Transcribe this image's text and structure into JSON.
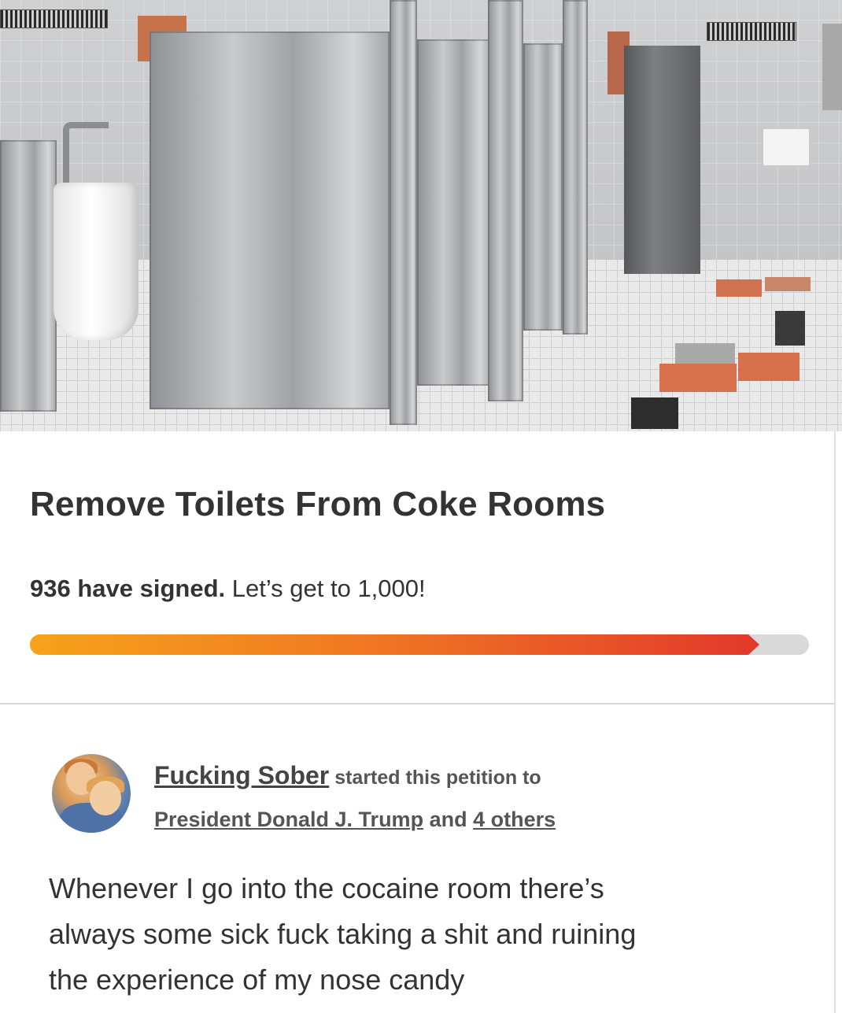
{
  "hero": {
    "description_icon": "restroom-photo"
  },
  "petition": {
    "title": "Remove Toilets From Coke Rooms",
    "signed_count_text": "936 have signed.",
    "goal_text": " Let’s get to 1,000!",
    "progress": {
      "signed": 936,
      "goal": 1000,
      "fraction": 0.936,
      "colors": {
        "start": "#f7a21b",
        "end": "#e33a2a",
        "track": "#d9d9d9"
      }
    }
  },
  "starter": {
    "name": "Fucking Sober",
    "action_text": " started this petition to",
    "target_name": "President Donald J. Trump",
    "and_text": " and ",
    "others_text": "4 others",
    "avatar_icon": "avatar-icon"
  },
  "body": {
    "lines": [
      "Whenever I go into the cocaine room there’s",
      "always some sick fuck taking a shit and ruining",
      "the experience of my nose candy"
    ]
  }
}
